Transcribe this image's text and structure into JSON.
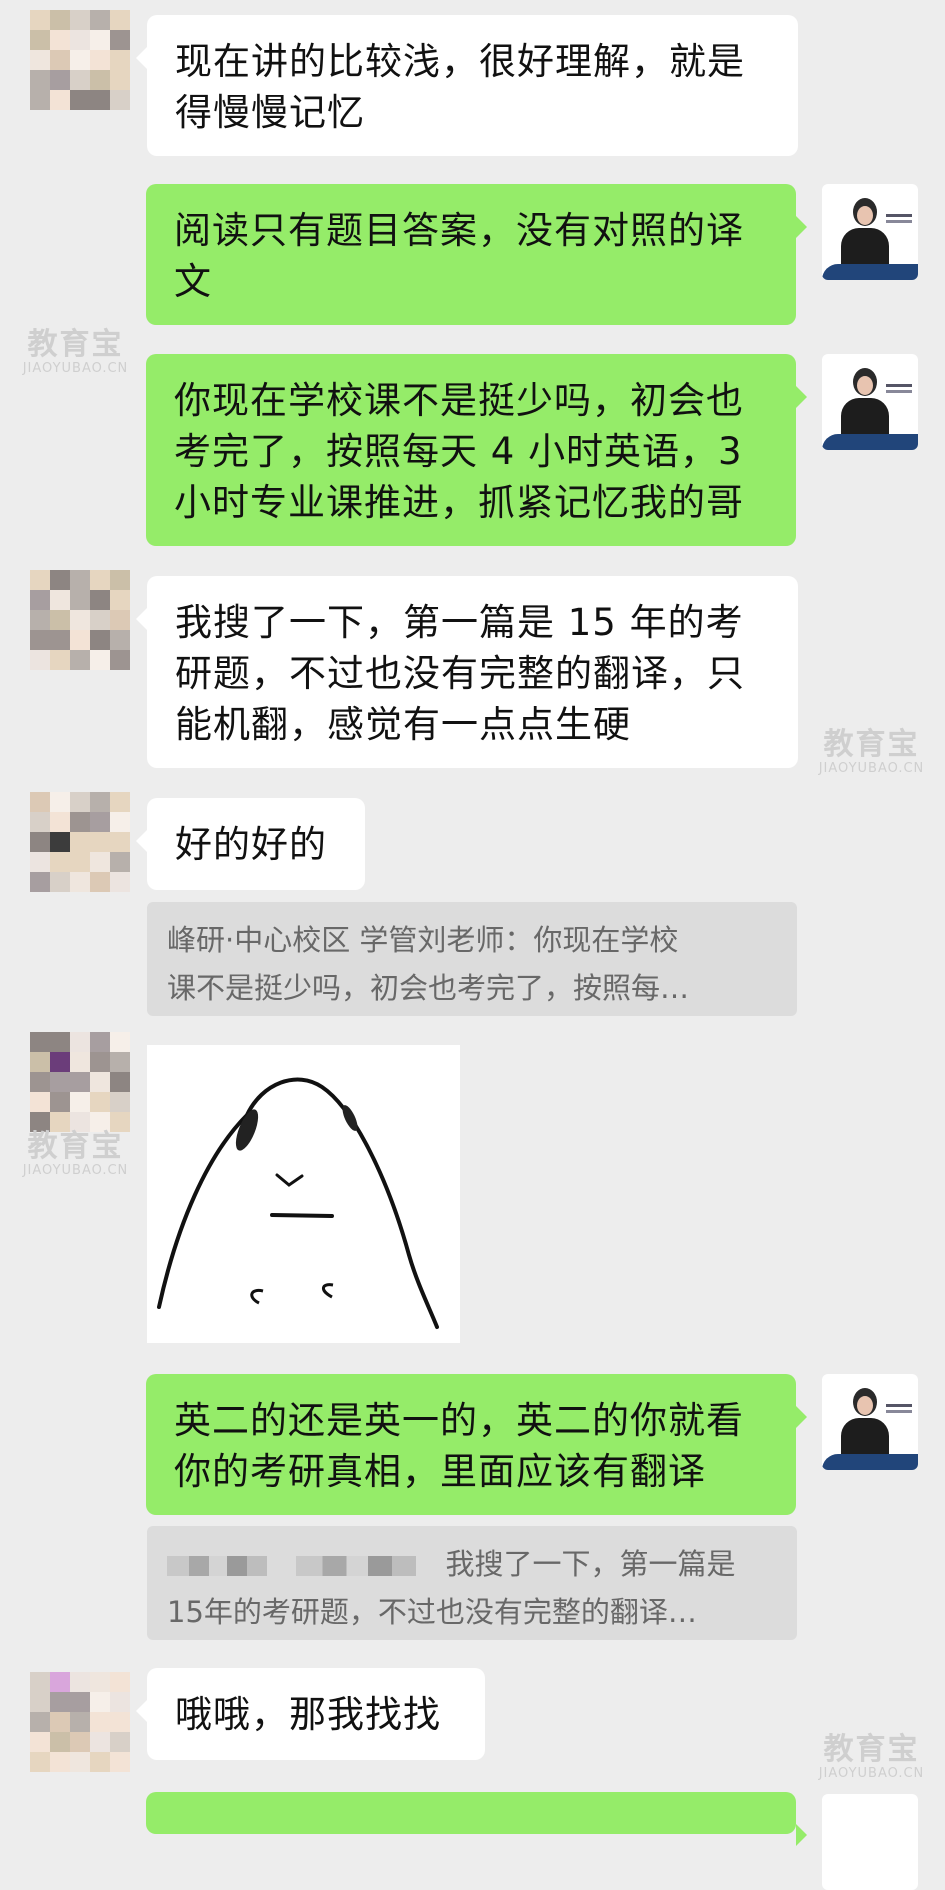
{
  "messages": [
    {
      "id": "m1",
      "side": "left",
      "lines": [
        "现在讲的比较浅，很好理解，就是",
        "得慢慢记忆"
      ]
    },
    {
      "id": "m2",
      "side": "right",
      "lines": [
        "阅读只有题目答案，没有对照的译",
        "文"
      ]
    },
    {
      "id": "m3",
      "side": "right",
      "lines": [
        "你现在学校课不是挺少吗，初会也",
        "考完了，按照每天 4 小时英语，3",
        "小时专业课推进，抓紧记忆我的哥"
      ]
    },
    {
      "id": "m4",
      "side": "left",
      "lines": [
        "我搜了一下，第一篇是 15 年的考",
        "研题，不过也没有完整的翻译，只",
        "能机翻，感觉有一点点生硬"
      ]
    },
    {
      "id": "m5",
      "side": "left",
      "lines": [
        "好的好的"
      ]
    },
    {
      "id": "m7",
      "side": "right",
      "lines": [
        "英二的还是英一的，英二的你就看",
        "你的考研真相，里面应该有翻译"
      ]
    },
    {
      "id": "m8",
      "side": "left",
      "lines": [
        "哦哦，那我找找"
      ]
    }
  ],
  "quotes": {
    "q1": {
      "lines": [
        "峰研·中心校区 学管刘老师：你现在学校",
        "课不是挺少吗，初会也考完了，按照每…"
      ]
    },
    "q2": {
      "lines": [
        "我搜了一下，第一篇是",
        "15年的考研题，不过也没有完整的翻译…"
      ]
    }
  },
  "watermark": {
    "cn": "教育宝",
    "en": "JIAOYUBAO.CN"
  },
  "colors": {
    "background": "#ededed",
    "self_bubble": "#95ec69",
    "other_bubble": "#ffffff",
    "quote_bg": "#dcdcdc"
  },
  "icons": {
    "sticker": "doodle-face-sticker",
    "avatar_self": "teacher-avatar",
    "avatar_other": "pixelated-avatar"
  }
}
